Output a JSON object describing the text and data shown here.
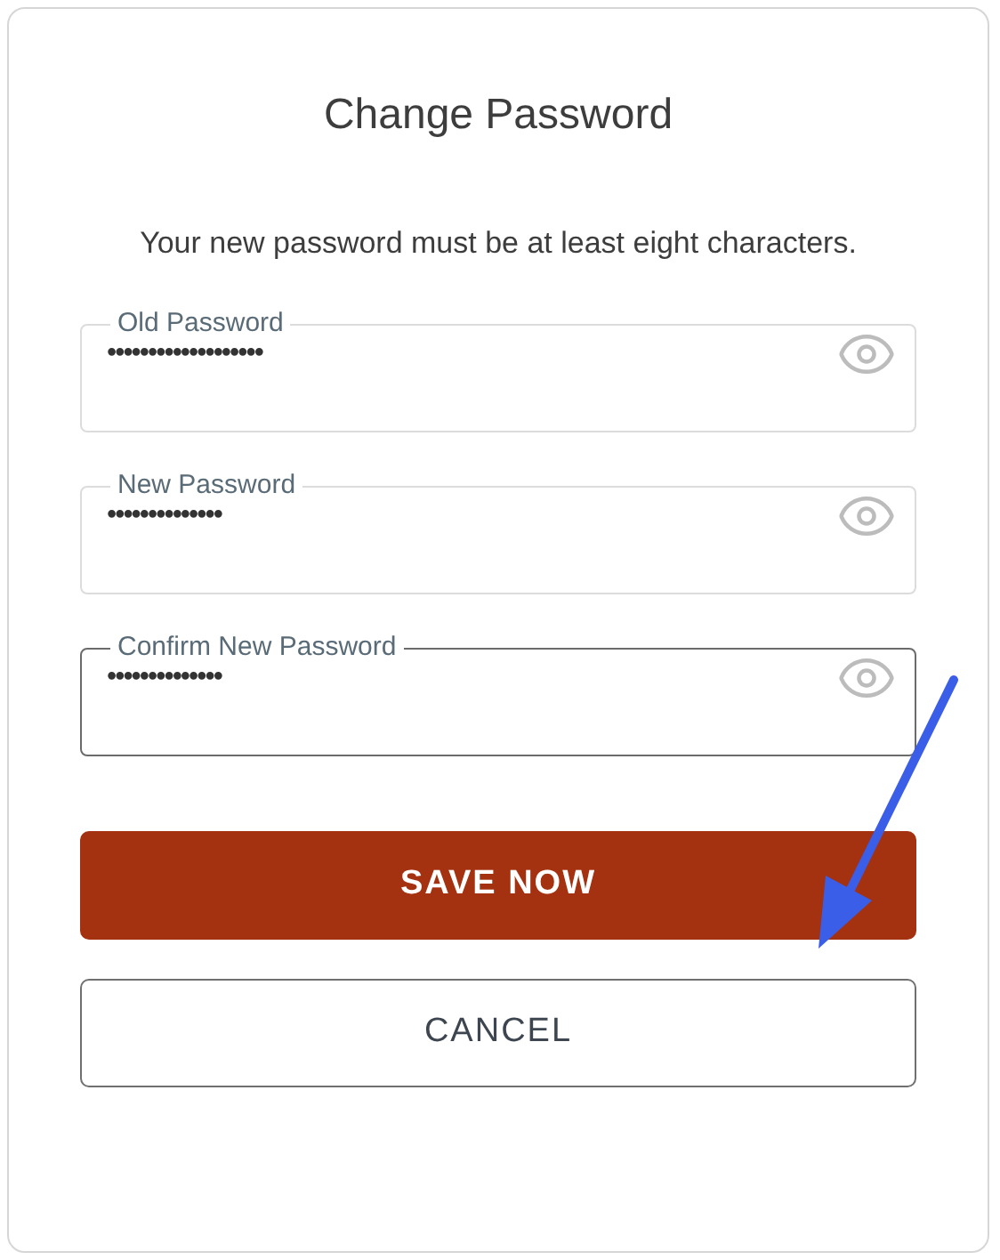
{
  "title": "Change Password",
  "description": "Your new password must be at least eight characters.",
  "fields": [
    {
      "label": "Old Password",
      "value": "•••••••••••••••••••",
      "focused": false
    },
    {
      "label": "New Password",
      "value": "••••••••••••••",
      "focused": false
    },
    {
      "label": "Confirm New Password",
      "value": "••••••••••••••",
      "focused": true
    }
  ],
  "buttons": [
    {
      "label": "SAVE NOW",
      "kind": "primary"
    },
    {
      "label": "CANCEL",
      "kind": "secondary"
    }
  ]
}
